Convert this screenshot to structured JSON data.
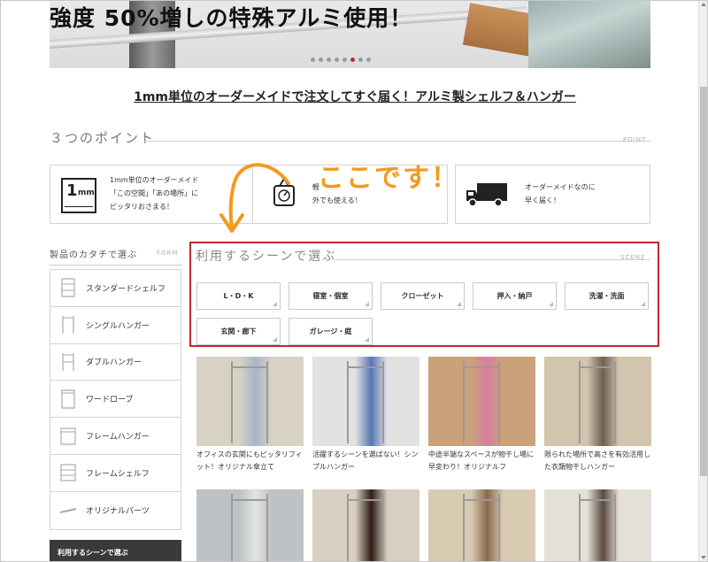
{
  "hero": {
    "headline": "強度 50%増しの特殊アルミ使用！",
    "slide_count": 8,
    "active_slide": 6
  },
  "tagline": "1mm単位のオーダーメイドで注文してすぐ届く！アルミ製シェルフ＆ハンガー",
  "points": {
    "title": "３つのポイント",
    "title_en": "POINT",
    "items": [
      {
        "icon": "ruler-1mm-icon",
        "text": "1mm単位のオーダーメイド\n「この空間」「あの場所」に\nピッタリおさまる！"
      },
      {
        "icon": "scale-icon",
        "text": "軽\n外でも使える！"
      },
      {
        "icon": "truck-icon",
        "text": "オーダーメイドなのに\n早く届く！"
      }
    ]
  },
  "annotation": {
    "text": "ここです！",
    "color": "#f39a1e"
  },
  "form_nav": {
    "title": "製品のカタチで選ぶ",
    "title_en": "FORM",
    "items": [
      "スタンダードシェルフ",
      "シングルハンガー",
      "ダブルハンガー",
      "ワードローブ",
      "フレームハンガー",
      "フレームシェルフ",
      "オリジナルパーツ"
    ],
    "scene_link": "利用するシーンで選ぶ"
  },
  "scene": {
    "title": "利用するシーンで選ぶ",
    "title_en": "SCENE",
    "highlight_color": "#c0282d",
    "buttons": [
      "L・D・K",
      "寝室・個室",
      "クローゼット",
      "押入・納戸",
      "洗濯・洗面",
      "玄関・廊下",
      "ガレージ・庭"
    ]
  },
  "photos": [
    {
      "caption": "オフィスの玄関にもピッタリフィット！オリジナル傘立て"
    },
    {
      "caption": "活躍するシーンを選ばない！シンプルハンガー"
    },
    {
      "caption": "中途半端なスペースが物干し場に早変わり！オリジナルフ"
    },
    {
      "caption": "限られた場所で高さを有効活用した衣類物干しハンガー"
    },
    {
      "caption": ""
    },
    {
      "caption": ""
    },
    {
      "caption": ""
    },
    {
      "caption": ""
    }
  ]
}
